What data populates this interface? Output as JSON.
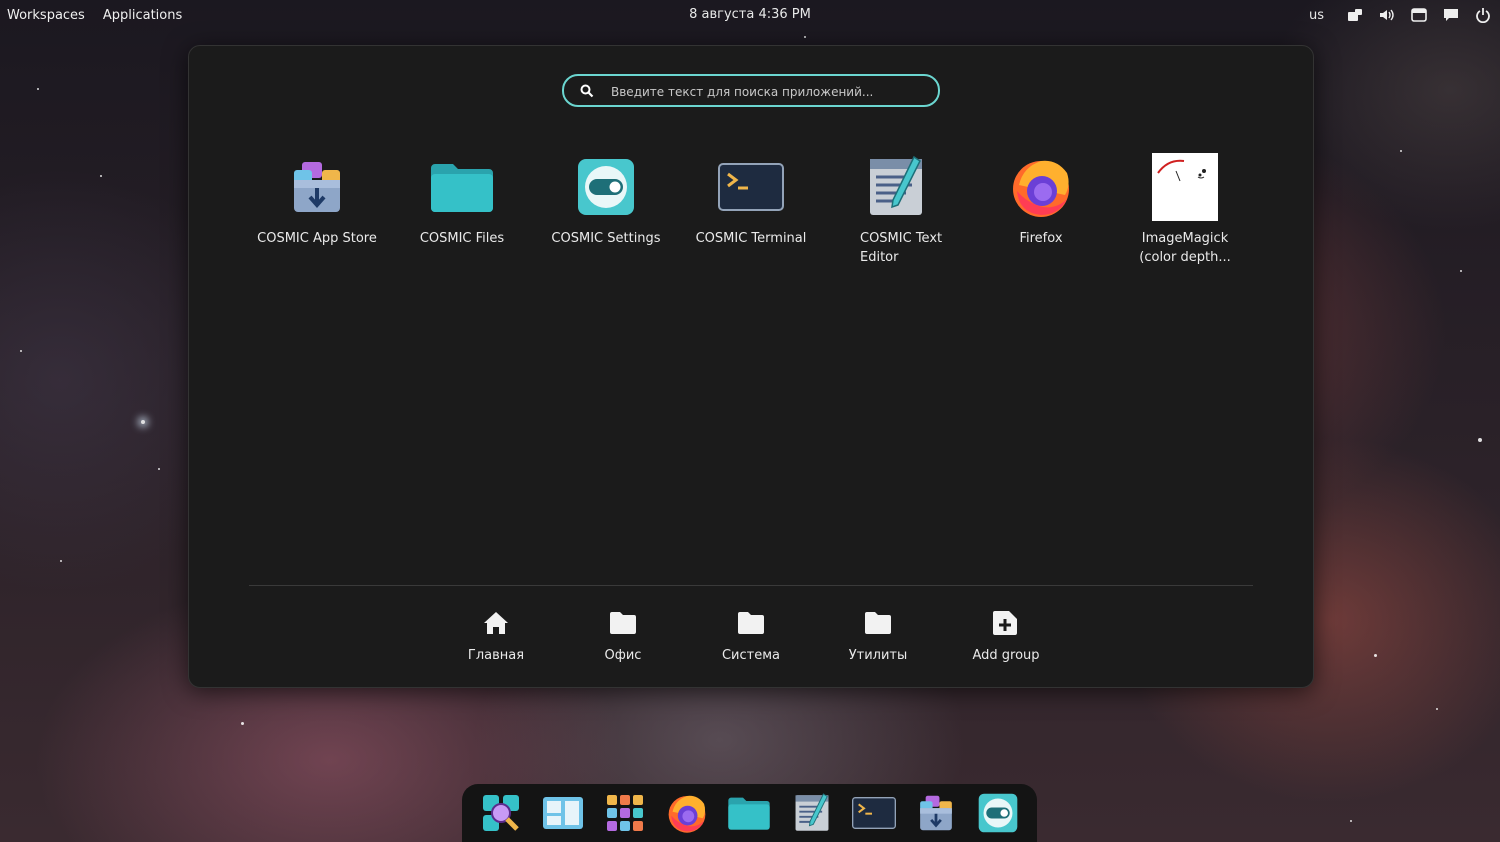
{
  "top_panel": {
    "workspaces": "Workspaces",
    "applications": "Applications",
    "clock": "8 августа 4:36 PM",
    "keyboard_layout": "us",
    "tray_icons": [
      "notification-tray-icon",
      "volume-icon",
      "screenshot-icon",
      "chat-icon",
      "power-icon"
    ]
  },
  "launcher": {
    "search_placeholder": "Введите текст для поиска приложений...",
    "apps": [
      {
        "label": "COSMIC App Store",
        "icon": "app-store-icon"
      },
      {
        "label": "COSMIC Files",
        "icon": "folder-icon"
      },
      {
        "label": "COSMIC Settings",
        "icon": "settings-toggle-icon"
      },
      {
        "label": "COSMIC Terminal",
        "icon": "terminal-icon"
      },
      {
        "label": "COSMIC Text Editor",
        "icon": "text-editor-icon"
      },
      {
        "label": "Firefox",
        "icon": "firefox-icon"
      },
      {
        "label": "ImageMagick (color depth...",
        "icon": "imagemagick-icon"
      }
    ],
    "groups": [
      {
        "label": "Главная",
        "icon": "home-icon"
      },
      {
        "label": "Офис",
        "icon": "folder-icon"
      },
      {
        "label": "Система",
        "icon": "folder-icon"
      },
      {
        "label": "Утилиты",
        "icon": "folder-icon"
      },
      {
        "label": "Add group",
        "icon": "add-folder-icon"
      }
    ]
  },
  "dock": {
    "items": [
      "launcher-icon",
      "workspaces-icon",
      "app-grid-icon",
      "firefox-icon",
      "files-icon",
      "text-editor-icon",
      "terminal-icon",
      "app-store-icon",
      "settings-icon"
    ]
  },
  "colors": {
    "accent": "#6bd6d0",
    "panel_bg": "#1b1b1b",
    "dock_bg": "#141414"
  }
}
